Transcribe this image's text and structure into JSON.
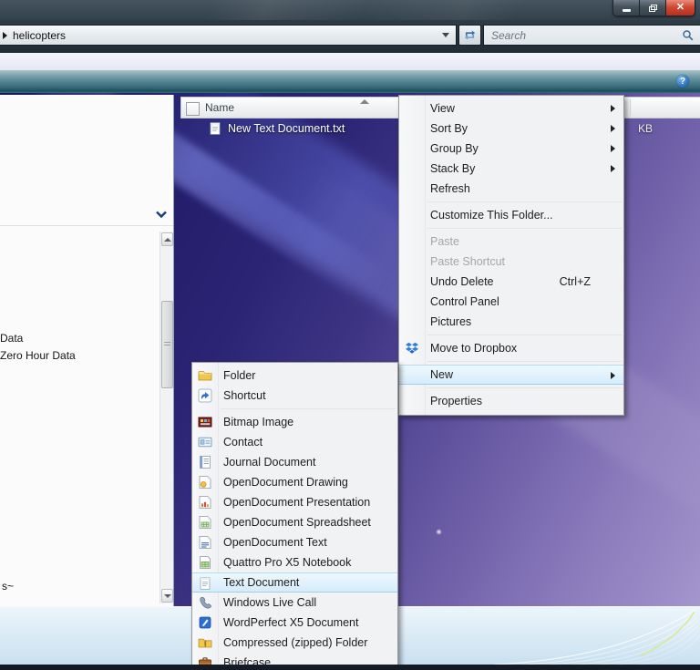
{
  "window": {
    "caption_buttons": [
      {
        "name": "minimize"
      },
      {
        "name": "restore"
      },
      {
        "name": "close"
      }
    ]
  },
  "address_bar": {
    "path": "helicopters",
    "search_placeholder": "Search"
  },
  "toolbar": {
    "help_label": "?"
  },
  "file_list": {
    "header": {
      "name_column": "Name"
    },
    "rows": [
      {
        "name": "New Text Document.txt",
        "icon": "text-document-icon"
      }
    ],
    "size_fragment": "KB"
  },
  "left_panel": {
    "items": [
      {
        "label": "Data"
      },
      {
        "label": "Zero Hour Data"
      }
    ],
    "bottom_text": "s~"
  },
  "context_menu": {
    "items": [
      {
        "label": "View",
        "submenu": true
      },
      {
        "label": "Sort By",
        "submenu": true
      },
      {
        "label": "Group By",
        "submenu": true
      },
      {
        "label": "Stack By",
        "submenu": true
      },
      {
        "label": "Refresh"
      },
      {
        "separator": true
      },
      {
        "label": "Customize This Folder..."
      },
      {
        "separator": true
      },
      {
        "label": "Paste",
        "disabled": true
      },
      {
        "label": "Paste Shortcut",
        "disabled": true
      },
      {
        "label": "Undo Delete",
        "shortcut": "Ctrl+Z"
      },
      {
        "label": "Control Panel"
      },
      {
        "label": "Pictures"
      },
      {
        "separator": true
      },
      {
        "label": "Move to Dropbox",
        "icon": "dropbox-icon"
      },
      {
        "separator": true
      },
      {
        "label": "New",
        "submenu": true,
        "highlighted": true
      },
      {
        "separator": true
      },
      {
        "label": "Properties"
      }
    ]
  },
  "new_submenu": {
    "items": [
      {
        "label": "Folder",
        "icon": "folder-icon"
      },
      {
        "label": "Shortcut",
        "icon": "shortcut-icon"
      },
      {
        "separator": true
      },
      {
        "label": "Bitmap Image",
        "icon": "bitmap-image-icon"
      },
      {
        "label": "Contact",
        "icon": "contact-icon"
      },
      {
        "label": "Journal Document",
        "icon": "journal-document-icon"
      },
      {
        "label": "OpenDocument Drawing",
        "icon": "opendocument-drawing-icon"
      },
      {
        "label": "OpenDocument Presentation",
        "icon": "opendocument-presentation-icon"
      },
      {
        "label": "OpenDocument Spreadsheet",
        "icon": "opendocument-spreadsheet-icon"
      },
      {
        "label": "OpenDocument Text",
        "icon": "opendocument-text-icon"
      },
      {
        "label": "Quattro Pro X5 Notebook",
        "icon": "quattro-pro-icon"
      },
      {
        "label": "Text Document",
        "icon": "text-document-icon",
        "highlighted": true
      },
      {
        "label": "Windows Live Call",
        "icon": "windows-live-call-icon"
      },
      {
        "label": "WordPerfect X5 Document",
        "icon": "wordperfect-icon"
      },
      {
        "label": "Compressed (zipped) Folder",
        "icon": "zip-folder-icon"
      },
      {
        "label": "Briefcase",
        "icon": "briefcase-icon"
      }
    ]
  },
  "colors": {
    "menu_highlight": "#d6ecf9",
    "menu_highlight_border": "#9ecfec",
    "titlebar": "#3a4752",
    "teal_band": "#2a5d6c",
    "details_pane": "#d3e6f3",
    "wallpaper_dark": "#221c69",
    "wallpaper_light": "#9b8cc7",
    "close_button": "#cf4a32"
  }
}
